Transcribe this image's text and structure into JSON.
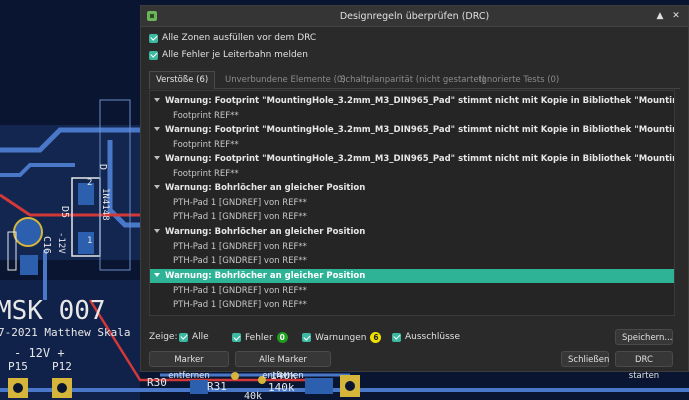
{
  "dialog": {
    "title": "Designregeln überprüfen (DRC)",
    "minimize_glyph": "▲",
    "close_glyph": "✕",
    "options": [
      {
        "label": "Alle Zonen ausfüllen vor dem DRC",
        "checked": true
      },
      {
        "label": "Alle Fehler je Leiterbahn melden",
        "checked": true
      }
    ],
    "tabs": [
      {
        "label": "Verstöße (6)",
        "active": true
      },
      {
        "label": "Unverbundene Elemente (0)",
        "active": false
      },
      {
        "label": "Schaltplanparität (nicht gestartet)",
        "active": false
      },
      {
        "label": "Ignorierte Tests (0)",
        "active": false
      }
    ],
    "violations": [
      {
        "title": "Warnung: Footprint \"MountingHole_3.2mm_M3_DIN965_Pad\" stimmt nicht mit Kopie in Bibliothek \"MountingHole\" überein.",
        "items": [
          "Footprint REF**"
        ],
        "selected": false
      },
      {
        "title": "Warnung: Footprint \"MountingHole_3.2mm_M3_DIN965_Pad\" stimmt nicht mit Kopie in Bibliothek \"MountingHole\" überein.",
        "items": [
          "Footprint REF**"
        ],
        "selected": false
      },
      {
        "title": "Warnung: Footprint \"MountingHole_3.2mm_M3_DIN965_Pad\" stimmt nicht mit Kopie in Bibliothek \"MountingHole\" überein.",
        "items": [
          "Footprint REF**"
        ],
        "selected": false
      },
      {
        "title": "Warnung: Bohrlöcher an gleicher Position",
        "items": [
          "PTH-Pad 1 [GNDREF] von REF**",
          "PTH-Pad 1 [GNDREF] von REF**"
        ],
        "selected": false
      },
      {
        "title": "Warnung: Bohrlöcher an gleicher Position",
        "items": [
          "PTH-Pad 1 [GNDREF] von REF**",
          "PTH-Pad 1 [GNDREF] von REF**"
        ],
        "selected": false
      },
      {
        "title": "Warnung: Bohrlöcher an gleicher Position",
        "items": [
          "PTH-Pad 1 [GNDREF] von REF**",
          "PTH-Pad 1 [GNDREF] von REF**"
        ],
        "selected": true
      }
    ],
    "filter": {
      "label": "Zeige:",
      "all": "Alle",
      "errors": "Fehler",
      "errors_count": "0",
      "warnings": "Warnungen",
      "warnings_count": "6",
      "exclusions": "Ausschlüsse",
      "save_label": "Speichern..."
    },
    "buttons": {
      "remove_marker": "Marker entfernen",
      "remove_all_markers": "Alle Marker entfernen",
      "close": "Schließen",
      "run_drc": "DRC starten"
    },
    "colors": {
      "accent": "#2fb397",
      "error_badge": "#1e9e1e",
      "warning_badge": "#f0e000"
    }
  },
  "pcb": {
    "labels": {
      "msk": "MSK 007",
      "year": "7-2021 Matthew Skala",
      "voltage": "- 12V +",
      "p15": "P15",
      "p12": "P12",
      "r30": "R30",
      "r31": "R31",
      "r140a": "140k",
      "r140b": "140k",
      "r40k": "40k",
      "c16": "C16",
      "d5": "D5",
      "neg12": "-12V",
      "n4148": "1N4148",
      "digit1": "1",
      "digit2": "2",
      "dmark": "D"
    }
  }
}
